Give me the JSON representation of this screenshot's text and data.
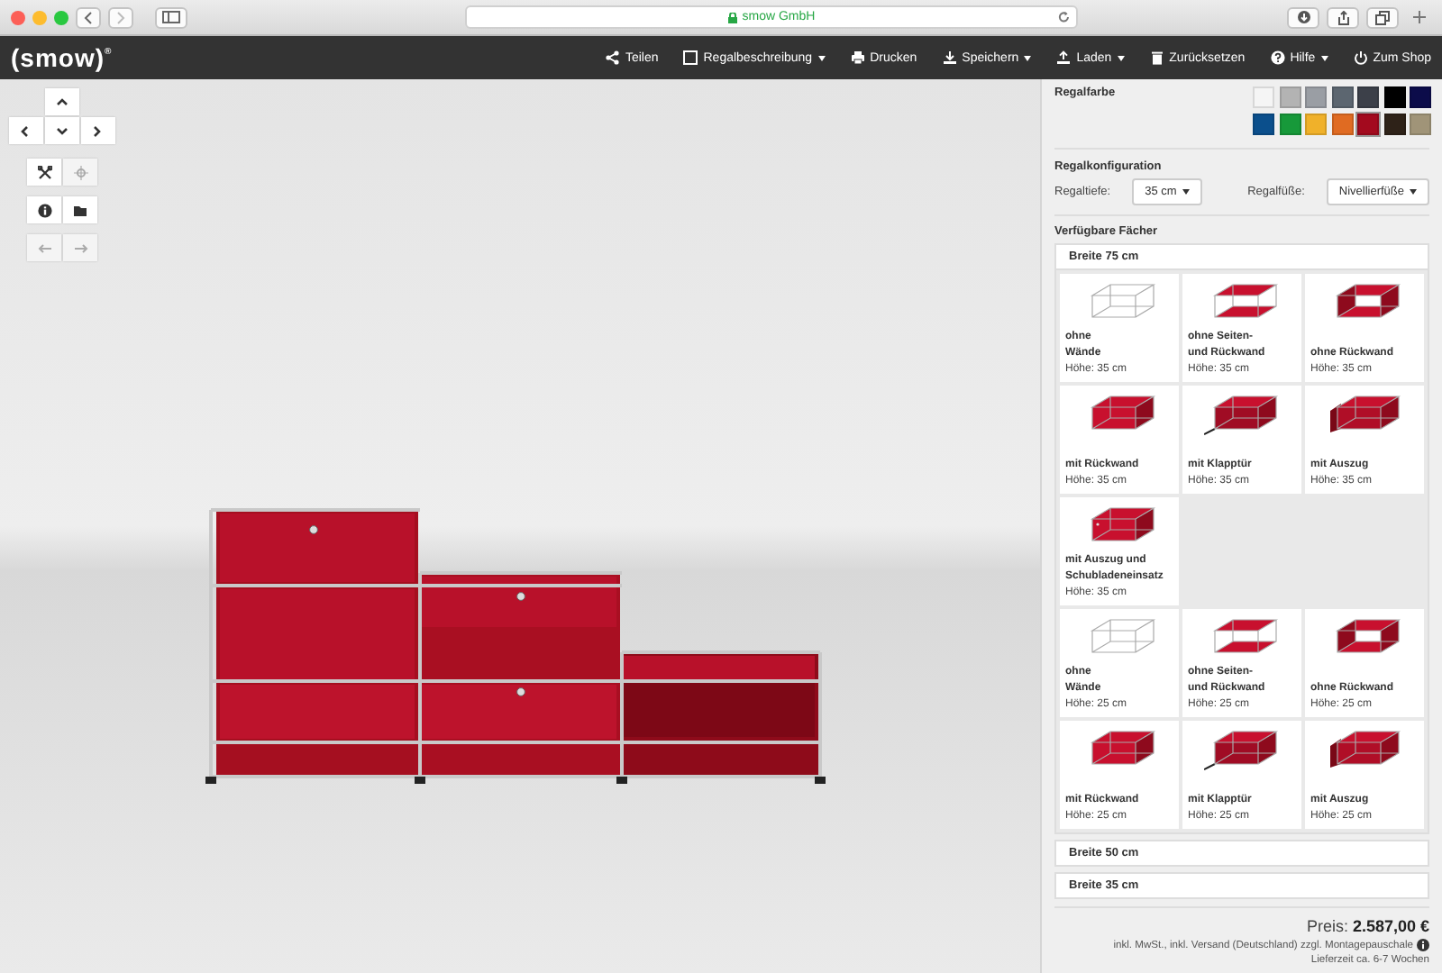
{
  "browser": {
    "address": "smow GmbH"
  },
  "navbar": {
    "logo": "(smow)",
    "logo_mark": "®",
    "items": [
      {
        "label": "Teilen",
        "kind": "share",
        "dropdown": false
      },
      {
        "label": "Regalbeschreibung",
        "kind": "square",
        "dropdown": true
      },
      {
        "label": "Drucken",
        "kind": "print",
        "dropdown": false
      },
      {
        "label": "Speichern",
        "kind": "download",
        "dropdown": true
      },
      {
        "label": "Laden",
        "kind": "upload",
        "dropdown": true
      },
      {
        "label": "Zurücksetzen",
        "kind": "trash",
        "dropdown": false
      },
      {
        "label": "Hilfe",
        "kind": "help",
        "dropdown": true
      },
      {
        "label": "Zum Shop",
        "kind": "power",
        "dropdown": false
      }
    ]
  },
  "viewport": {
    "pan_buttons": [
      {
        "kind": "up"
      },
      {
        "kind": "left"
      },
      {
        "kind": "down"
      },
      {
        "kind": "right"
      }
    ],
    "tools": [
      {
        "kind": "scissors",
        "disabled": false
      },
      {
        "kind": "crosshair",
        "disabled": true
      },
      {
        "kind": "info",
        "disabled": false
      },
      {
        "kind": "folder",
        "disabled": false
      },
      {
        "kind": "undo",
        "disabled": true
      },
      {
        "kind": "redo",
        "disabled": true
      }
    ]
  },
  "sidebar": {
    "colors": {
      "title": "Regalfarbe",
      "swatches": [
        {
          "color": "#f5f5f5",
          "selected": false
        },
        {
          "color": "#b3b3b3",
          "selected": false
        },
        {
          "color": "#9a9ea4",
          "selected": false
        },
        {
          "color": "#5c6670",
          "selected": false
        },
        {
          "color": "#3c4049",
          "selected": false
        },
        {
          "color": "#000000",
          "selected": false
        },
        {
          "color": "#0c0c4a",
          "selected": false
        },
        {
          "color": "#0b4f8c",
          "selected": false
        },
        {
          "color": "#17993a",
          "selected": false
        },
        {
          "color": "#f0b12a",
          "selected": false
        },
        {
          "color": "#e06b22",
          "selected": false
        },
        {
          "color": "#a30a1e",
          "selected": true
        },
        {
          "color": "#2e2218",
          "selected": false
        },
        {
          "color": "#a09478",
          "selected": false
        }
      ]
    },
    "config": {
      "title": "Regalkonfiguration",
      "fields": [
        {
          "label": "Regaltiefe:",
          "value": "35 cm"
        },
        {
          "label": "Regalfüße:",
          "value": "Nivellierfüße"
        }
      ]
    },
    "compartments": {
      "title": "Verfügbare Fächer",
      "groups": [
        {
          "title": "Breite 75 cm",
          "expanded": true,
          "sections": [
            {
              "items": [
                {
                  "kind": "frame",
                  "name_lines": [
                    "ohne",
                    "Wände"
                  ],
                  "height": "Höhe: 35 cm"
                },
                {
                  "kind": "shelves",
                  "name_lines": [
                    "ohne Seiten-",
                    "und Rückwand"
                  ],
                  "height": "Höhe: 35 cm"
                },
                {
                  "kind": "open",
                  "name_lines": [
                    "ohne Rückwand"
                  ],
                  "height": "Höhe: 35 cm"
                },
                {
                  "kind": "back",
                  "name_lines": [
                    "mit Rückwand"
                  ],
                  "height": "Höhe: 35 cm"
                },
                {
                  "kind": "flap",
                  "name_lines": [
                    "mit Klapptür"
                  ],
                  "height": "Höhe: 35 cm"
                },
                {
                  "kind": "drawer",
                  "name_lines": [
                    "mit Auszug"
                  ],
                  "height": "Höhe: 35 cm"
                },
                {
                  "kind": "closed",
                  "name_lines": [
                    "mit Auszug und",
                    "Schubladeneinsatz"
                  ],
                  "height": "Höhe: 35 cm"
                }
              ]
            },
            {
              "items": [
                {
                  "kind": "frame",
                  "name_lines": [
                    "ohne",
                    "Wände"
                  ],
                  "height": "Höhe: 25 cm"
                },
                {
                  "kind": "shelves",
                  "name_lines": [
                    "ohne Seiten-",
                    "und Rückwand"
                  ],
                  "height": "Höhe: 25 cm"
                },
                {
                  "kind": "open",
                  "name_lines": [
                    "ohne Rückwand"
                  ],
                  "height": "Höhe: 25 cm"
                },
                {
                  "kind": "back",
                  "name_lines": [
                    "mit Rückwand"
                  ],
                  "height": "Höhe: 25 cm"
                },
                {
                  "kind": "flap",
                  "name_lines": [
                    "mit Klapptür"
                  ],
                  "height": "Höhe: 25 cm"
                },
                {
                  "kind": "drawer",
                  "name_lines": [
                    "mit Auszug"
                  ],
                  "height": "Höhe: 25 cm"
                }
              ]
            }
          ]
        },
        {
          "title": "Breite 50 cm",
          "expanded": false
        },
        {
          "title": "Breite 35 cm",
          "expanded": false
        }
      ]
    },
    "price": {
      "label": "Preis:",
      "value": "2.587,00 €",
      "note": "inkl. MwSt., inkl. Versand (Deutschland) zzgl. Montagepauschale",
      "delivery": "Lieferzeit ca. 6-7 Wochen"
    }
  }
}
